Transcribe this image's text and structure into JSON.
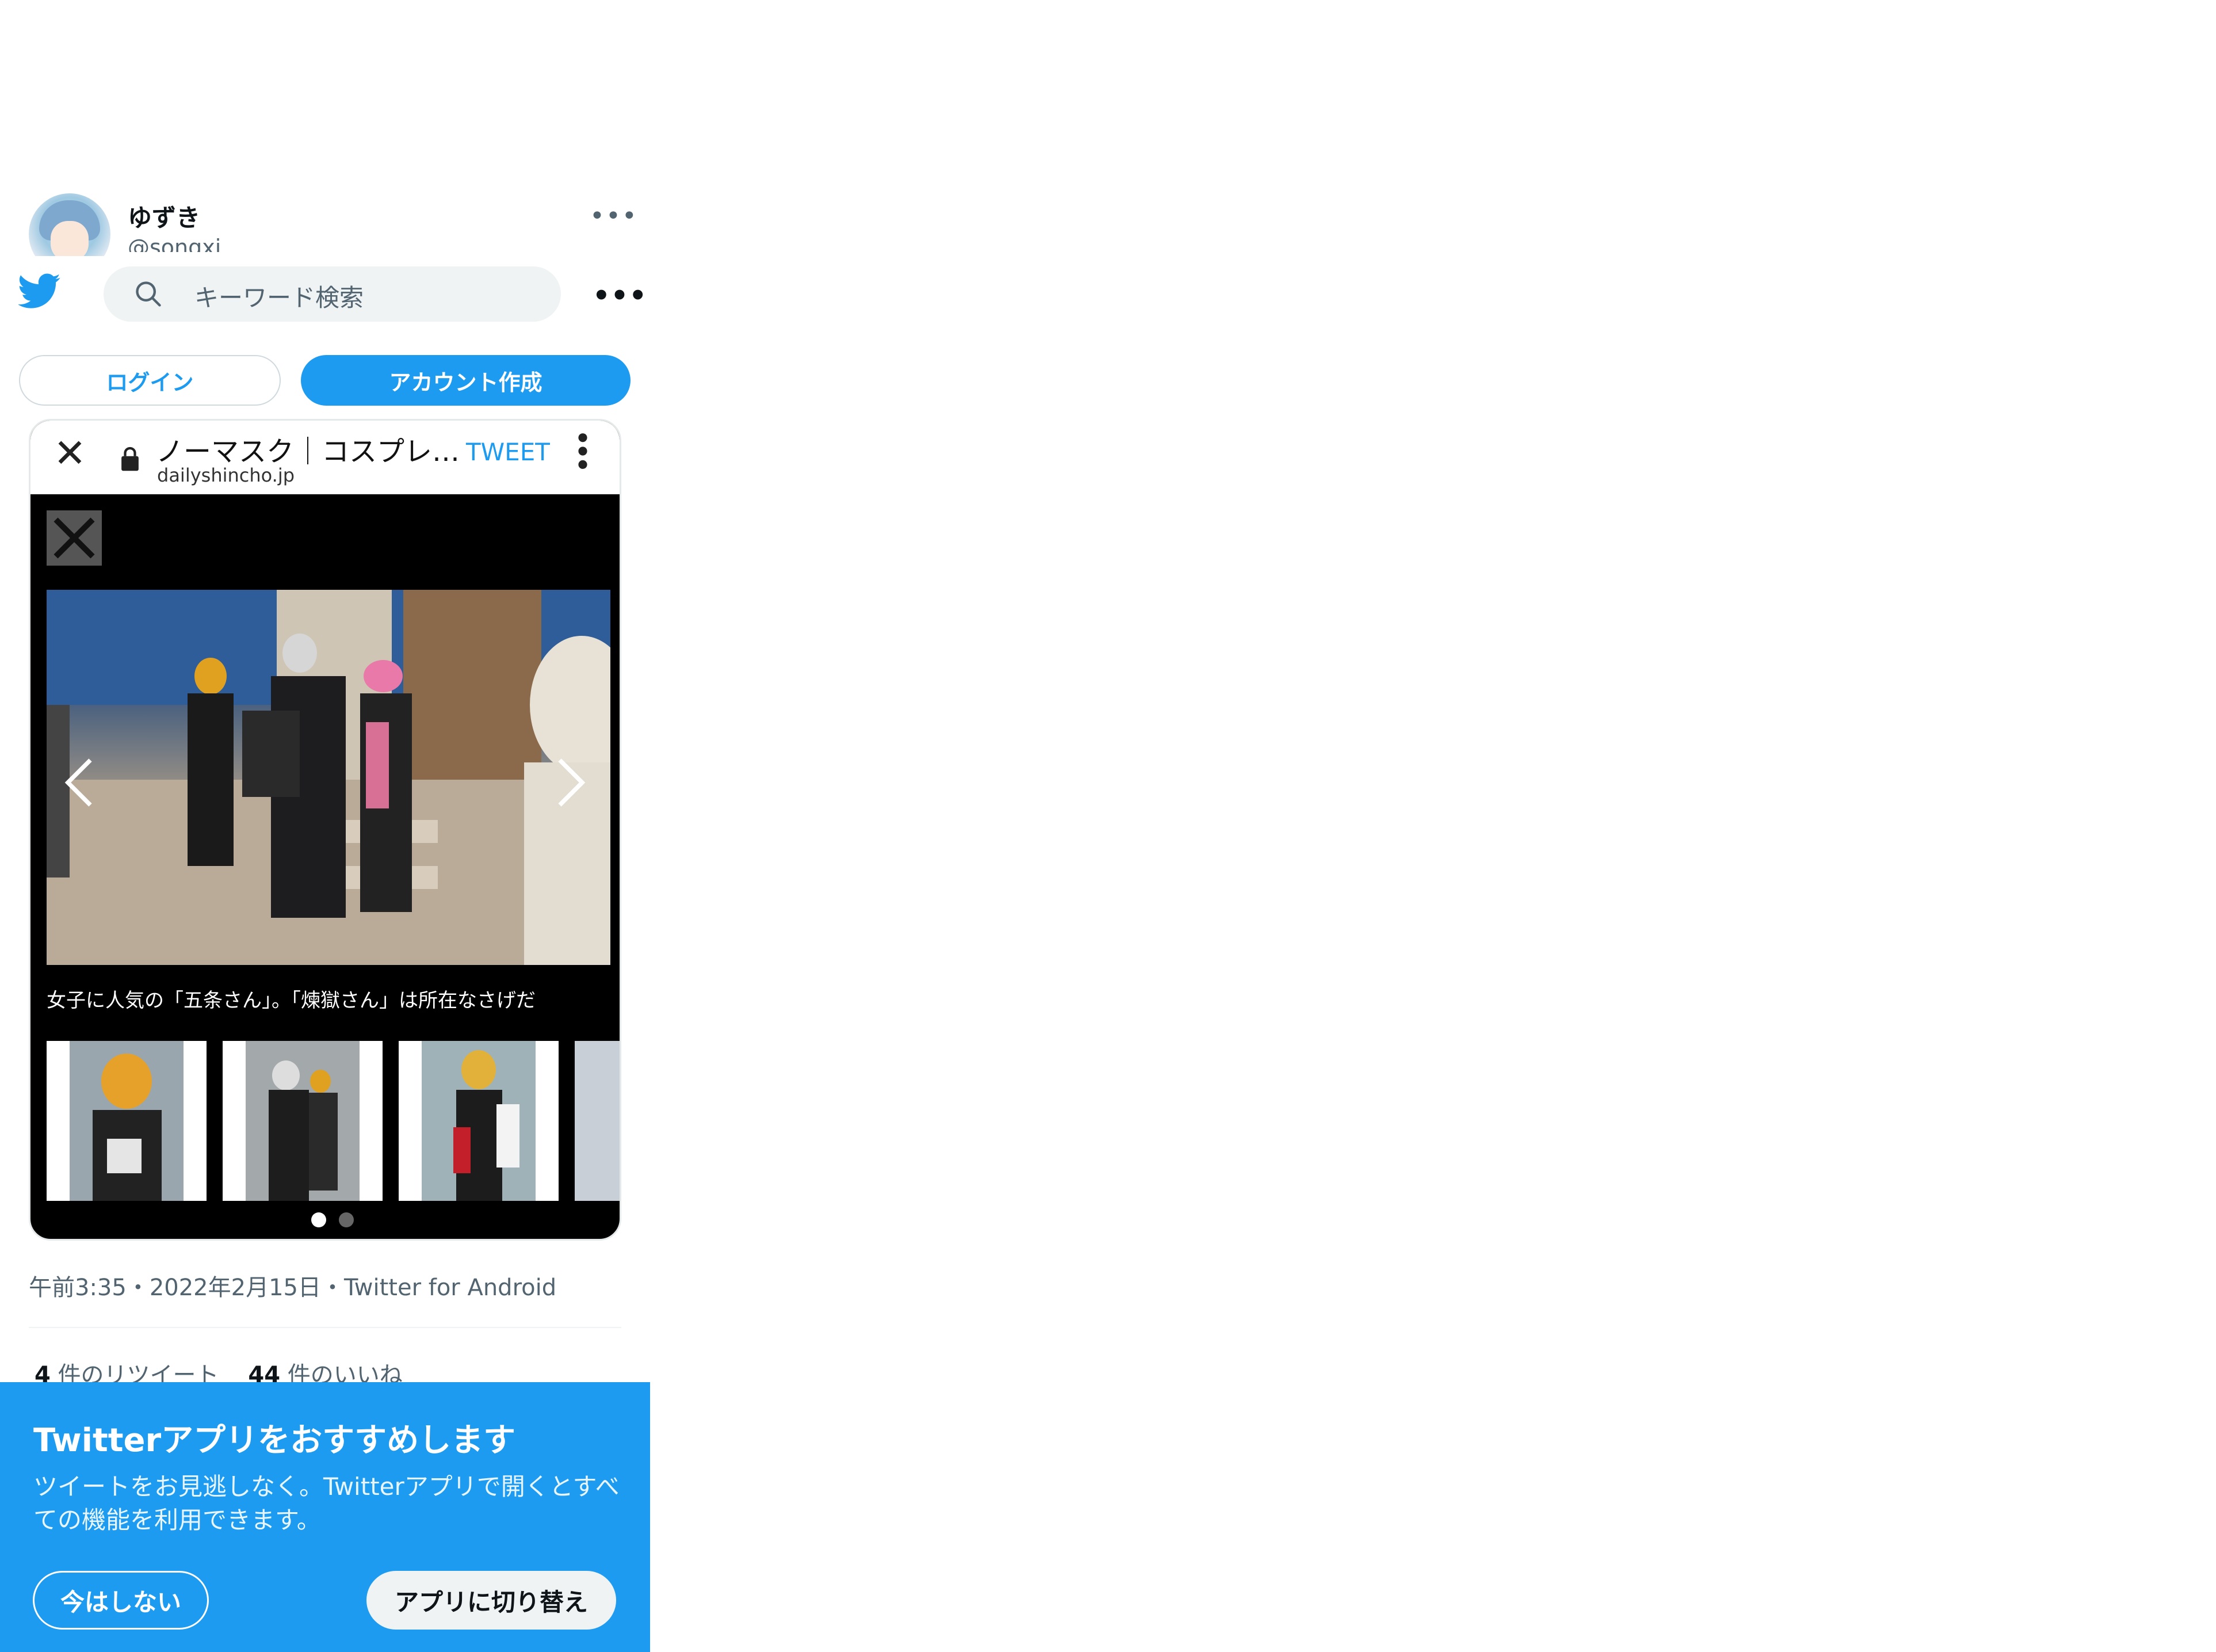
{
  "tweet": {
    "display_name": "ゆずき",
    "handle": "@songxi",
    "timestamp": "午前3:35・2022年2月15日・Twitter for Android",
    "retweet_count": "4",
    "retweet_label": " 件のリツイート",
    "like_count": "44",
    "like_label": " 件のいいね"
  },
  "nav": {
    "search_placeholder": "キーワード検索",
    "login_label": "ログイン",
    "signup_label": "アカウント作成"
  },
  "embedded": {
    "page_title": "ノーマスク｜コスプレ…",
    "domain": "dailyshincho.jp",
    "tweet_button": "TWEET",
    "caption": "女子に人気の「五条さん」。「煉獄さん」は所在なさげだ"
  },
  "banner": {
    "title": "Twitterアプリをおすすめします",
    "body": "ツイートをお見逃しなく。Twitterアプリで開くとすべての機能を利用できます。",
    "not_now_label": "今はしない",
    "switch_label": "アプリに切り替え"
  },
  "colors": {
    "brand": "#1d9bf0",
    "text_secondary": "#536471"
  },
  "icons": [
    "twitter-bird-icon",
    "search-icon",
    "more-icon",
    "close-icon",
    "lock-icon",
    "kebab-icon",
    "chevron-left-icon",
    "chevron-right-icon"
  ]
}
